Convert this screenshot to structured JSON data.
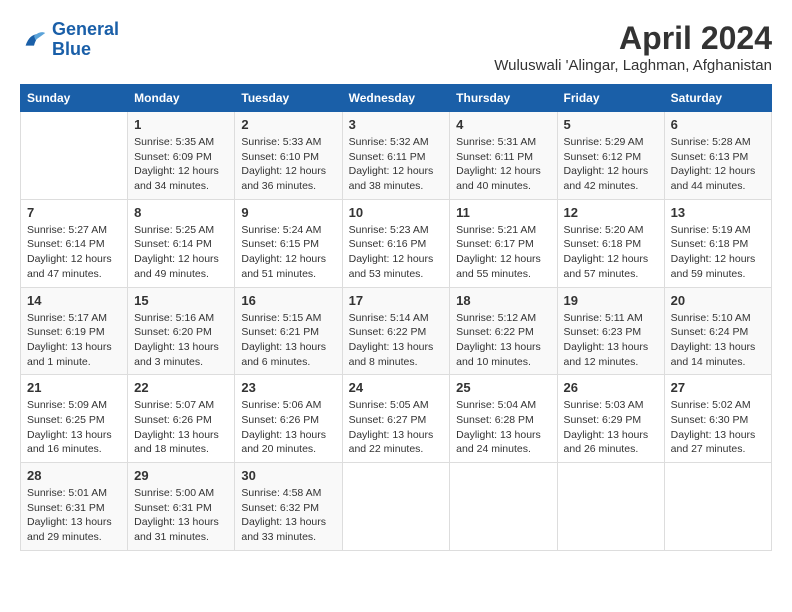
{
  "header": {
    "logo_line1": "General",
    "logo_line2": "Blue",
    "month": "April 2024",
    "location": "Wuluswali 'Alingar, Laghman, Afghanistan"
  },
  "weekdays": [
    "Sunday",
    "Monday",
    "Tuesday",
    "Wednesday",
    "Thursday",
    "Friday",
    "Saturday"
  ],
  "weeks": [
    [
      {
        "day": "",
        "text": ""
      },
      {
        "day": "1",
        "text": "Sunrise: 5:35 AM\nSunset: 6:09 PM\nDaylight: 12 hours\nand 34 minutes."
      },
      {
        "day": "2",
        "text": "Sunrise: 5:33 AM\nSunset: 6:10 PM\nDaylight: 12 hours\nand 36 minutes."
      },
      {
        "day": "3",
        "text": "Sunrise: 5:32 AM\nSunset: 6:11 PM\nDaylight: 12 hours\nand 38 minutes."
      },
      {
        "day": "4",
        "text": "Sunrise: 5:31 AM\nSunset: 6:11 PM\nDaylight: 12 hours\nand 40 minutes."
      },
      {
        "day": "5",
        "text": "Sunrise: 5:29 AM\nSunset: 6:12 PM\nDaylight: 12 hours\nand 42 minutes."
      },
      {
        "day": "6",
        "text": "Sunrise: 5:28 AM\nSunset: 6:13 PM\nDaylight: 12 hours\nand 44 minutes."
      }
    ],
    [
      {
        "day": "7",
        "text": "Sunrise: 5:27 AM\nSunset: 6:14 PM\nDaylight: 12 hours\nand 47 minutes."
      },
      {
        "day": "8",
        "text": "Sunrise: 5:25 AM\nSunset: 6:14 PM\nDaylight: 12 hours\nand 49 minutes."
      },
      {
        "day": "9",
        "text": "Sunrise: 5:24 AM\nSunset: 6:15 PM\nDaylight: 12 hours\nand 51 minutes."
      },
      {
        "day": "10",
        "text": "Sunrise: 5:23 AM\nSunset: 6:16 PM\nDaylight: 12 hours\nand 53 minutes."
      },
      {
        "day": "11",
        "text": "Sunrise: 5:21 AM\nSunset: 6:17 PM\nDaylight: 12 hours\nand 55 minutes."
      },
      {
        "day": "12",
        "text": "Sunrise: 5:20 AM\nSunset: 6:18 PM\nDaylight: 12 hours\nand 57 minutes."
      },
      {
        "day": "13",
        "text": "Sunrise: 5:19 AM\nSunset: 6:18 PM\nDaylight: 12 hours\nand 59 minutes."
      }
    ],
    [
      {
        "day": "14",
        "text": "Sunrise: 5:17 AM\nSunset: 6:19 PM\nDaylight: 13 hours\nand 1 minute."
      },
      {
        "day": "15",
        "text": "Sunrise: 5:16 AM\nSunset: 6:20 PM\nDaylight: 13 hours\nand 3 minutes."
      },
      {
        "day": "16",
        "text": "Sunrise: 5:15 AM\nSunset: 6:21 PM\nDaylight: 13 hours\nand 6 minutes."
      },
      {
        "day": "17",
        "text": "Sunrise: 5:14 AM\nSunset: 6:22 PM\nDaylight: 13 hours\nand 8 minutes."
      },
      {
        "day": "18",
        "text": "Sunrise: 5:12 AM\nSunset: 6:22 PM\nDaylight: 13 hours\nand 10 minutes."
      },
      {
        "day": "19",
        "text": "Sunrise: 5:11 AM\nSunset: 6:23 PM\nDaylight: 13 hours\nand 12 minutes."
      },
      {
        "day": "20",
        "text": "Sunrise: 5:10 AM\nSunset: 6:24 PM\nDaylight: 13 hours\nand 14 minutes."
      }
    ],
    [
      {
        "day": "21",
        "text": "Sunrise: 5:09 AM\nSunset: 6:25 PM\nDaylight: 13 hours\nand 16 minutes."
      },
      {
        "day": "22",
        "text": "Sunrise: 5:07 AM\nSunset: 6:26 PM\nDaylight: 13 hours\nand 18 minutes."
      },
      {
        "day": "23",
        "text": "Sunrise: 5:06 AM\nSunset: 6:26 PM\nDaylight: 13 hours\nand 20 minutes."
      },
      {
        "day": "24",
        "text": "Sunrise: 5:05 AM\nSunset: 6:27 PM\nDaylight: 13 hours\nand 22 minutes."
      },
      {
        "day": "25",
        "text": "Sunrise: 5:04 AM\nSunset: 6:28 PM\nDaylight: 13 hours\nand 24 minutes."
      },
      {
        "day": "26",
        "text": "Sunrise: 5:03 AM\nSunset: 6:29 PM\nDaylight: 13 hours\nand 26 minutes."
      },
      {
        "day": "27",
        "text": "Sunrise: 5:02 AM\nSunset: 6:30 PM\nDaylight: 13 hours\nand 27 minutes."
      }
    ],
    [
      {
        "day": "28",
        "text": "Sunrise: 5:01 AM\nSunset: 6:31 PM\nDaylight: 13 hours\nand 29 minutes."
      },
      {
        "day": "29",
        "text": "Sunrise: 5:00 AM\nSunset: 6:31 PM\nDaylight: 13 hours\nand 31 minutes."
      },
      {
        "day": "30",
        "text": "Sunrise: 4:58 AM\nSunset: 6:32 PM\nDaylight: 13 hours\nand 33 minutes."
      },
      {
        "day": "",
        "text": ""
      },
      {
        "day": "",
        "text": ""
      },
      {
        "day": "",
        "text": ""
      },
      {
        "day": "",
        "text": ""
      }
    ]
  ]
}
